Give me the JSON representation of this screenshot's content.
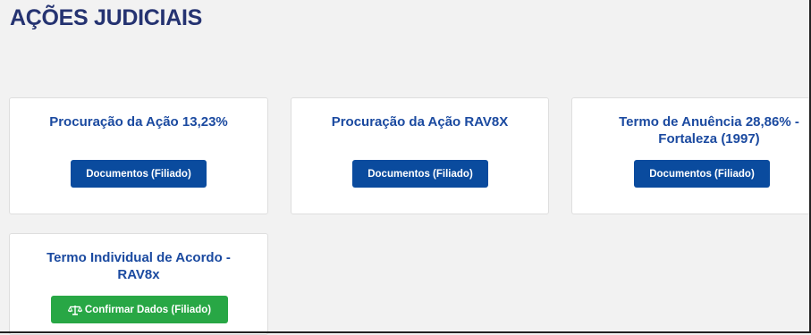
{
  "page": {
    "title": "AÇÕES JUDICIAIS"
  },
  "cards": [
    {
      "title": "Procuração da Ação 13,23%",
      "button": {
        "label": "Documentos (Filiado)",
        "color": "#0a4b9e"
      }
    },
    {
      "title": "Procuração da Ação RAV8X",
      "button": {
        "label": "Documentos (Filiado)",
        "color": "#0a4b9e"
      }
    },
    {
      "title": "Termo de Anuência 28,86% - Fortaleza (1997)",
      "button": {
        "label": "Documentos (Filiado)",
        "color": "#0a4b9e"
      }
    },
    {
      "title": "Termo Individual de Acordo - RAV8x",
      "button": {
        "label": "Confirmar Dados (Filiado)",
        "color": "#28a745",
        "icon": "balance-scale-icon"
      }
    }
  ],
  "colors": {
    "page_title": "#253371",
    "card_title": "#1b4aa0",
    "primary_button": "#0a4b9e",
    "success_button": "#28a745",
    "background": "#f2f2f2"
  }
}
